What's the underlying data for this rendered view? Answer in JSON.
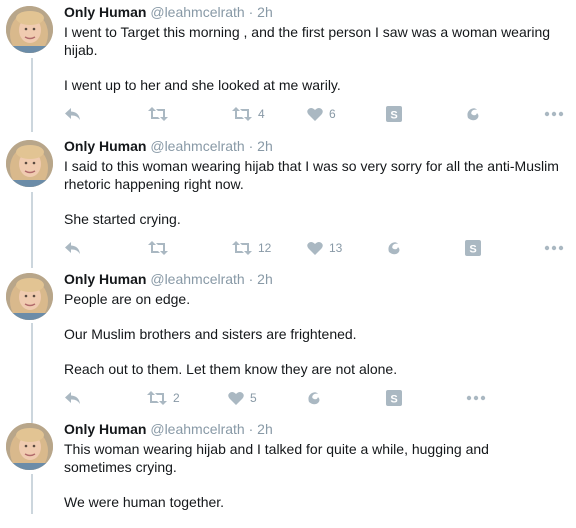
{
  "tweets": [
    {
      "name": "Only Human",
      "handle": "@leahmcelrath",
      "time": "· 2h",
      "paragraphs": [
        "I went to Target this morning , and the first person I saw was a woman wearing hijab.",
        "I went up to her and she looked at me warily."
      ],
      "retweet_count": "4",
      "like_count": "6"
    },
    {
      "name": "Only Human",
      "handle": "@leahmcelrath",
      "time": "· 2h",
      "paragraphs": [
        "I said to this woman wearing hijab that I was so very sorry for all the anti-Muslim rhetoric happening right now.",
        "She started crying."
      ],
      "retweet_count": "12",
      "like_count": "13"
    },
    {
      "name": "Only Human",
      "handle": "@leahmcelrath",
      "time": "· 2h",
      "paragraphs": [
        "People are on edge.",
        "Our Muslim brothers and sisters are frightened.",
        "Reach out to them. Let them know they are not alone."
      ],
      "retweet_count": "2",
      "like_count": "5"
    },
    {
      "name": "Only Human",
      "handle": "@leahmcelrath",
      "time": "· 2h",
      "paragraphs": [
        "This woman wearing hijab and I talked for quite a while, hugging and sometimes crying.",
        "We were human together."
      ]
    }
  ],
  "icons": {
    "reply": "reply-icon",
    "retweet": "retweet-icon",
    "like": "heart-icon",
    "s_app": "s-square-icon",
    "swirl": "swirl-icon",
    "more": "more-dots-icon"
  },
  "colors": {
    "icon": "#aab8c2",
    "muted": "#8899a6",
    "thread": "#ccd6dd"
  }
}
